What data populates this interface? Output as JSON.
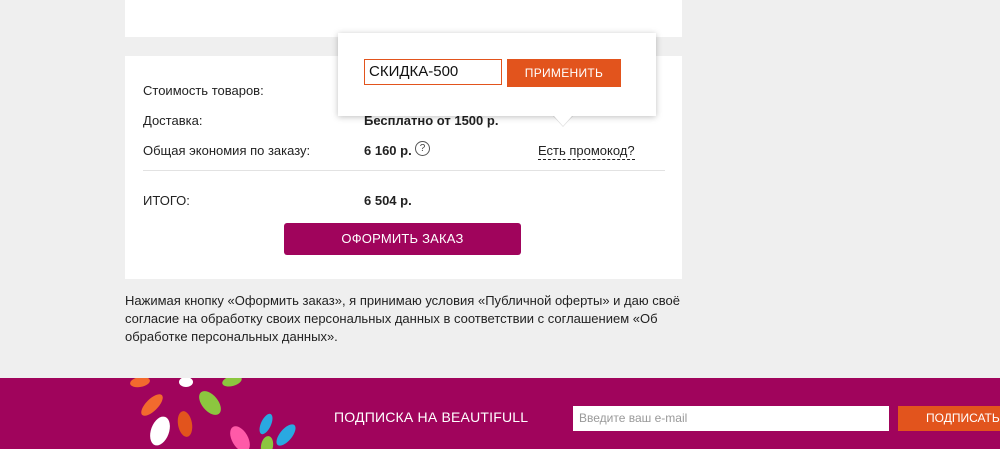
{
  "summary": {
    "goods_label": "Стоимость товаров:",
    "delivery_label": "Доставка:",
    "delivery_value": "Бесплатно от 1500 р.",
    "savings_label": "Общая экономия по заказу:",
    "savings_value": "6 160 р.",
    "help_icon": "?",
    "promo_link": "Есть промокод?",
    "total_label": "ИТОГО:",
    "total_value": "6 504 р.",
    "order_button": "ОФОРМИТЬ ЗАКАЗ"
  },
  "promo_popover": {
    "input_value": "СКИДКА-500",
    "apply_button": "ПРИМЕНИТЬ"
  },
  "consent_text": "Нажимая кнопку «Оформить заказ», я принимаю условия «Публичной оферты» и даю своё согласие на обработку своих персональных данных в соответствии с соглашением «Об обработке персональных данных».",
  "footer": {
    "subscribe_title": "ПОДПИСКА НА BEAUTIFULL",
    "email_placeholder": "Введите ваш e-mail",
    "subscribe_button": "ПОДПИСАТЬ"
  },
  "colors": {
    "brand": "#a0045c",
    "accent": "#e2541d",
    "background": "#efefef"
  }
}
